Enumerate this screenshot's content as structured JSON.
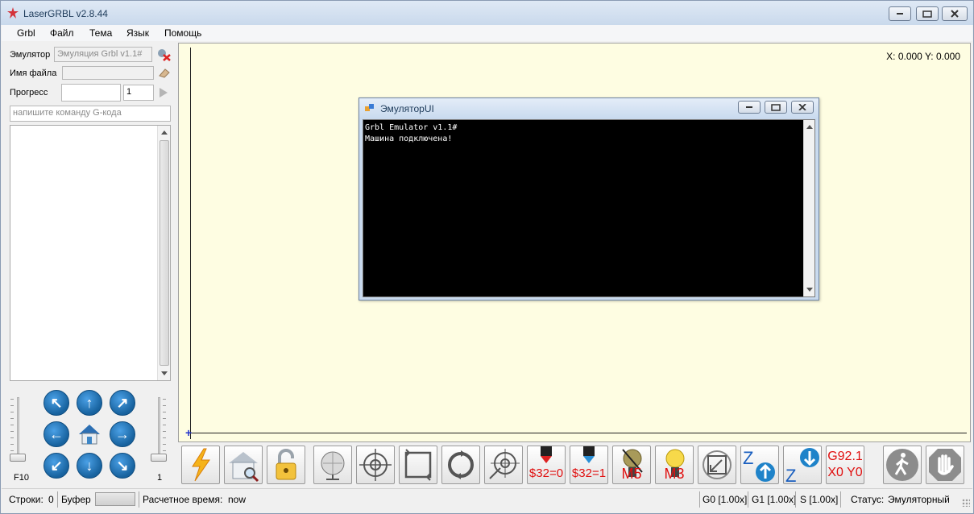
{
  "window": {
    "title": "LaserGRBL v2.8.44"
  },
  "menu": [
    "Grbl",
    "Файл",
    "Тема",
    "Язык",
    "Помощь"
  ],
  "left": {
    "emulator_label": "Эмулятор",
    "emulator_value": "Эмуляция Grbl v1.1#",
    "filename_label": "Имя файла",
    "progress_label": "Прогресс",
    "progress_count": "1",
    "command_placeholder": "напишите команду G-кода",
    "f10_label": "F10",
    "right_slider_label": "1"
  },
  "canvas": {
    "coords": "X: 0.000 Y: 0.000"
  },
  "emulator_window": {
    "title": "ЭмуляторUI",
    "console_lines": [
      "Grbl Emulator v1.1#",
      "Машина подключена!"
    ]
  },
  "toolbar": {
    "buttons": [
      {
        "name": "connect-button",
        "icon": "lightning-icon"
      },
      {
        "name": "homing-button",
        "icon": "house-search-icon"
      },
      {
        "name": "unlock-button",
        "icon": "padlock-icon"
      },
      {
        "name": "globe-button",
        "icon": "globe-pin-icon"
      },
      {
        "name": "center-target-button",
        "icon": "crosshair-icon"
      },
      {
        "name": "frame-button",
        "icon": "frame-icon"
      },
      {
        "name": "cycle-button",
        "icon": "cycle-icon"
      },
      {
        "name": "target-move-button",
        "icon": "target-arrow-icon"
      },
      {
        "name": "laser-mode-off-button",
        "label": "$32=0"
      },
      {
        "name": "laser-mode-on-button",
        "label": "$32=1"
      },
      {
        "name": "m5-button",
        "label": "M5"
      },
      {
        "name": "m3-button",
        "label": "M3"
      },
      {
        "name": "resize-button",
        "icon": "diagonal-arrow-icon"
      },
      {
        "name": "z-up-button",
        "icon": "z-up-icon"
      },
      {
        "name": "z-down-button",
        "icon": "z-down-icon"
      },
      {
        "name": "g92-button",
        "label_line1": "G92.1",
        "label_line2": "X0 Y0"
      },
      {
        "name": "walk-button",
        "icon": "walking-person-icon"
      },
      {
        "name": "stop-button",
        "icon": "hand-stop-icon"
      }
    ]
  },
  "status": {
    "lines_label": "Строки:",
    "lines_value": "0",
    "buffer_label": "Буфер",
    "eta_label": "Расчетное время:",
    "eta_value": "now",
    "g0": "G0 [1.00x]",
    "g1": "G1 [1.00x]",
    "s": "S [1.00x]",
    "status_label": "Статус:",
    "status_value": "Эмуляторный"
  },
  "colors": {
    "canvas_bg": "#fefde2",
    "jog_blue": "#17629e",
    "red_text": "#e01010"
  }
}
